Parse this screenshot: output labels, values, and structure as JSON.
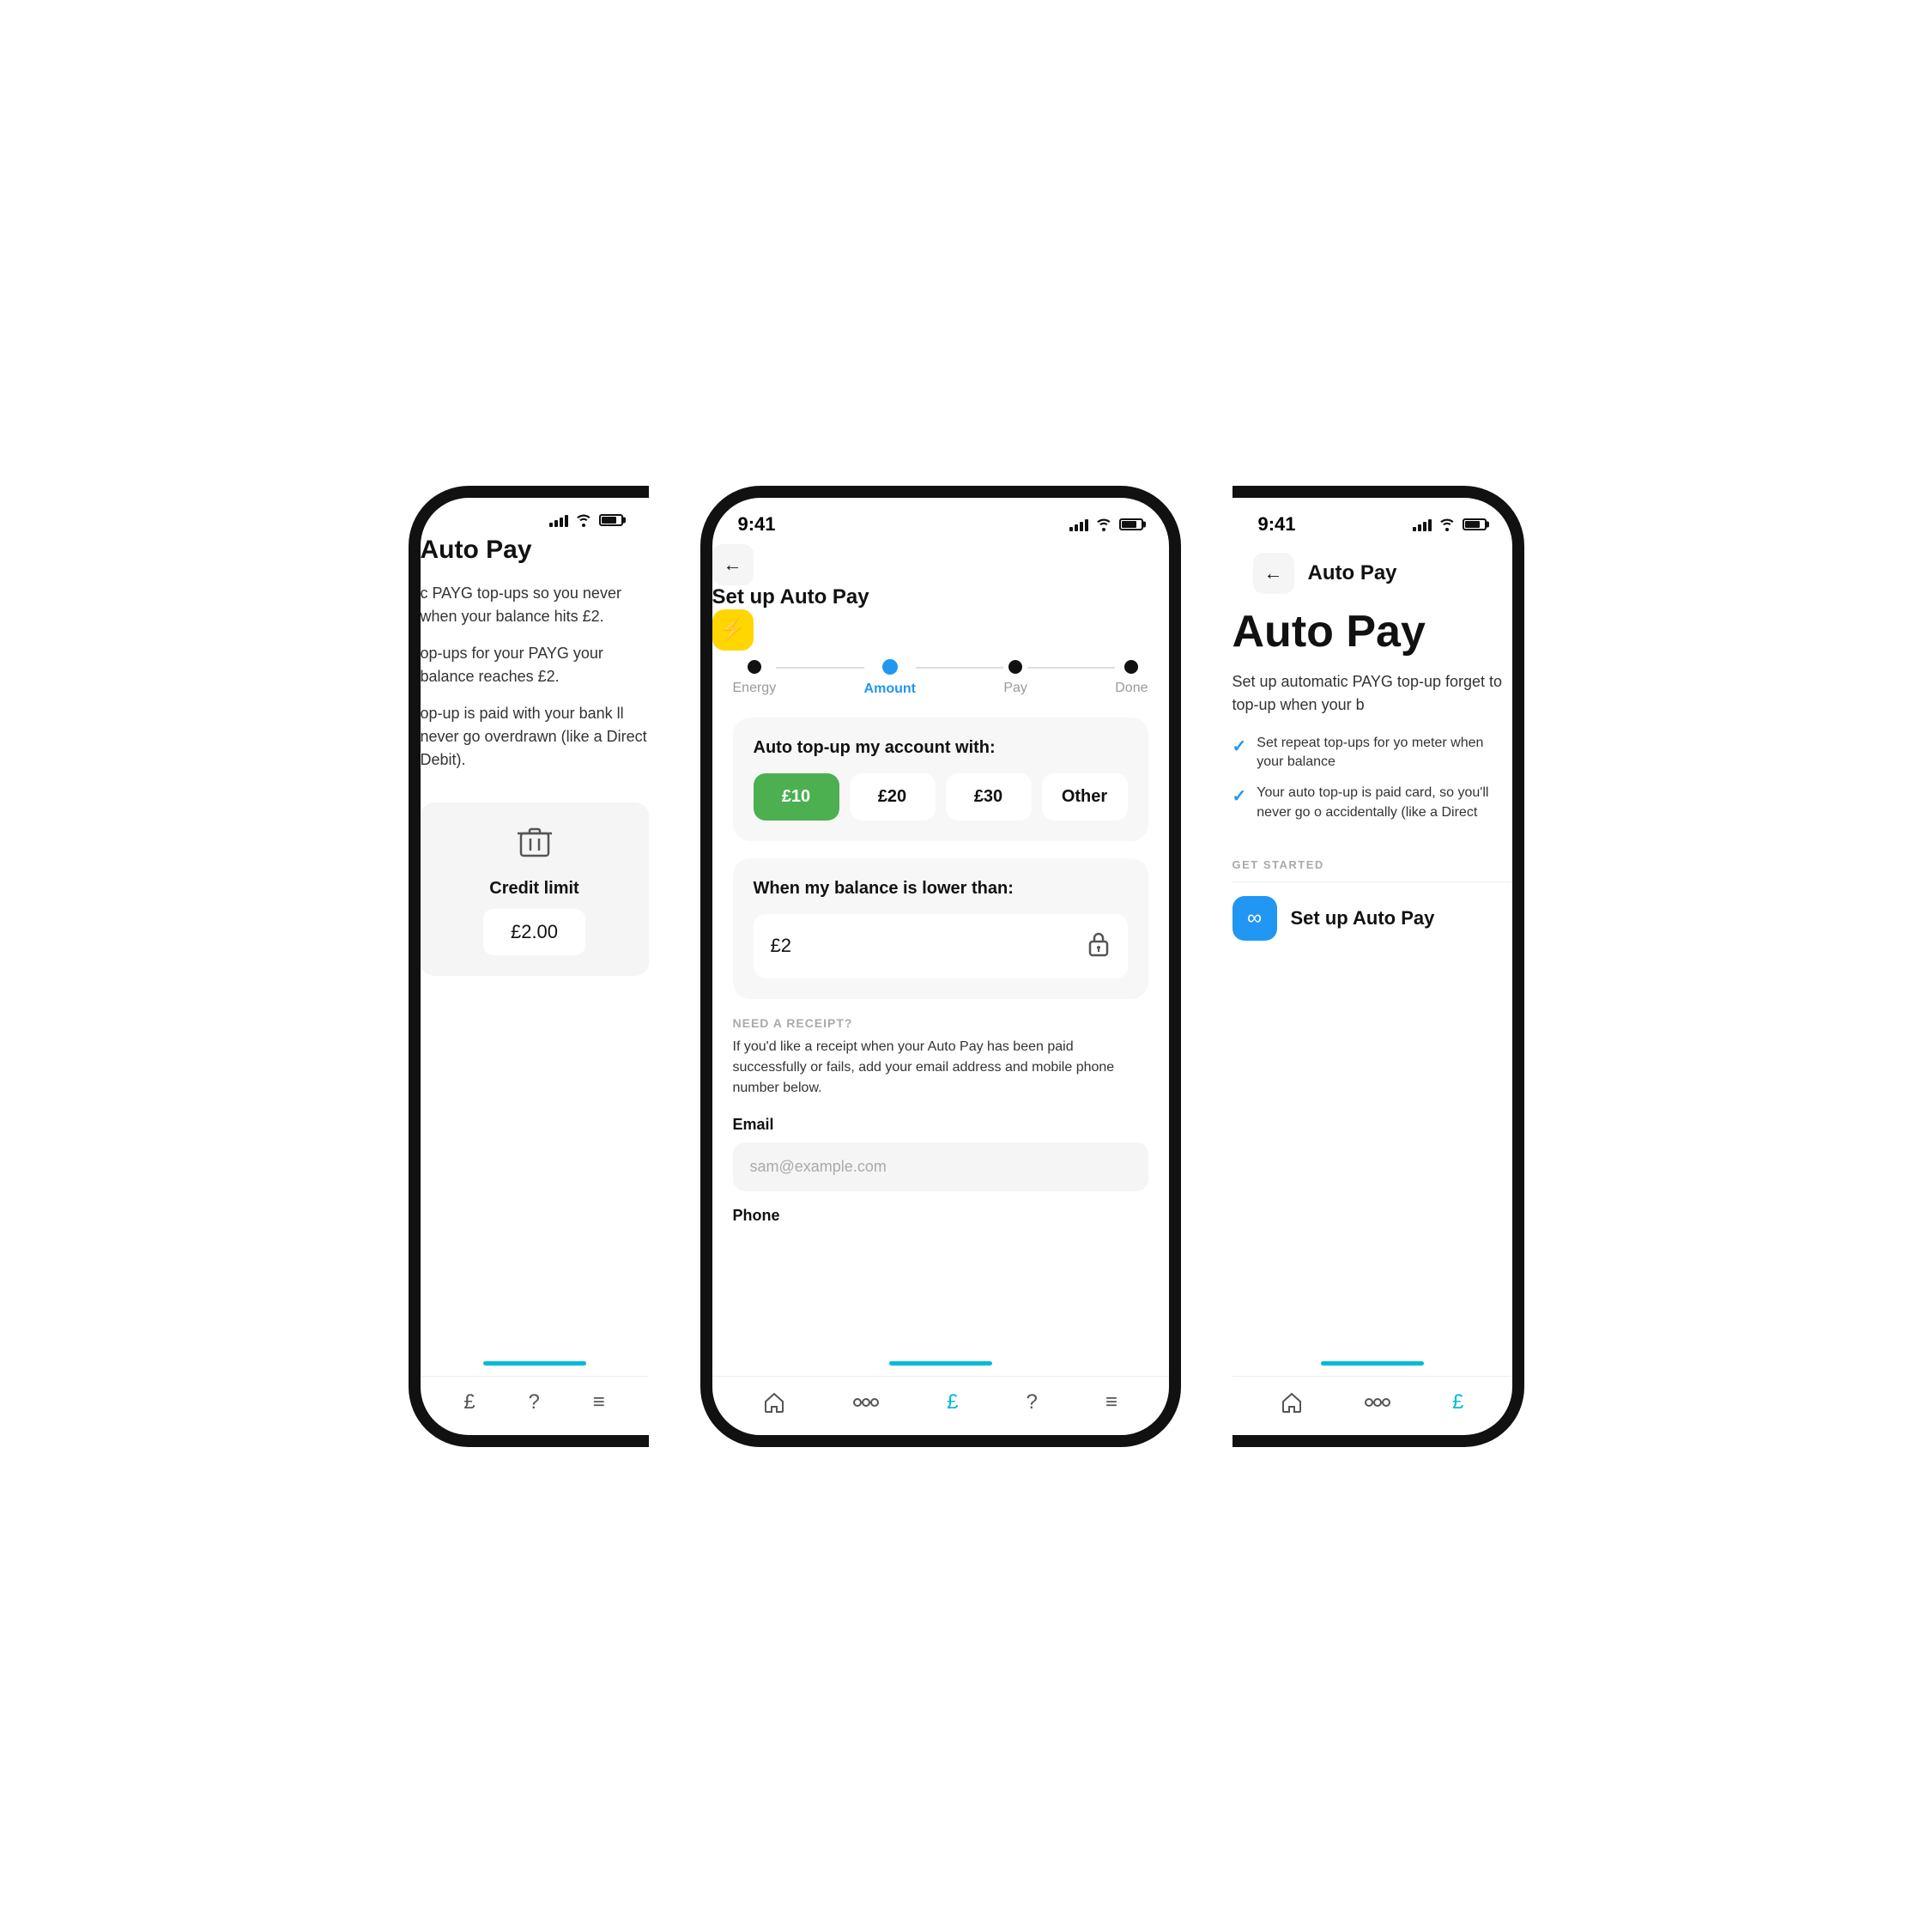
{
  "left_phone": {
    "title": "Auto Pay",
    "body1": "c PAYG top-ups so you never when your balance hits £2.",
    "body2": "op-ups for your PAYG your balance reaches £2.",
    "body3": "op-up is paid with your bank ll never go overdrawn (like a Direct Debit).",
    "credit_limit_label": "Credit limit",
    "credit_limit_value": "£2.00",
    "nav": {
      "items": [
        "£",
        "?",
        "≡"
      ]
    }
  },
  "mid_phone": {
    "status_time": "9:41",
    "header_title": "Set up Auto Pay",
    "steps": [
      {
        "label": "Energy",
        "state": "inactive"
      },
      {
        "label": "Amount",
        "state": "active"
      },
      {
        "label": "Pay",
        "state": "inactive"
      },
      {
        "label": "Done",
        "state": "inactive"
      }
    ],
    "amount_card": {
      "title": "Auto top-up my account with:",
      "options": [
        {
          "label": "£10",
          "selected": true
        },
        {
          "label": "£20",
          "selected": false
        },
        {
          "label": "£30",
          "selected": false
        },
        {
          "label": "Other",
          "selected": false
        }
      ]
    },
    "balance_card": {
      "title": "When my balance is lower than:",
      "value": "£2"
    },
    "receipt_section": {
      "label": "NEED A RECEIPT?",
      "description": "If you'd like a receipt when your Auto Pay has been paid successfully or fails, add your email address and mobile phone number below.",
      "email_label": "Email",
      "email_placeholder": "sam@example.com",
      "phone_label": "Phone"
    },
    "nav": {
      "items": [
        "home",
        "connect",
        "billing",
        "help",
        "menu"
      ]
    }
  },
  "right_phone": {
    "status_time": "9:41",
    "header_title": "Auto Pay",
    "main_title": "Auto Pay",
    "description": "Set up automatic PAYG top-up forget to top-up when your b",
    "checklist": [
      "Set repeat top-ups for yo meter when your balance",
      "Your auto top-up is paid card, so you'll never go o accidentally (like a Direct"
    ],
    "get_started_label": "GET STARTED",
    "setup_button_label": "Set up Auto Pay",
    "nav": {
      "items": [
        "home",
        "connect",
        "billing"
      ]
    }
  },
  "colors": {
    "accent_blue": "#2196F3",
    "accent_green": "#4CAF50",
    "accent_yellow": "#FFD600",
    "accent_cyan": "#00bcd4",
    "text_primary": "#111111",
    "text_secondary": "#555555",
    "bg_card": "#f7f7f7"
  }
}
